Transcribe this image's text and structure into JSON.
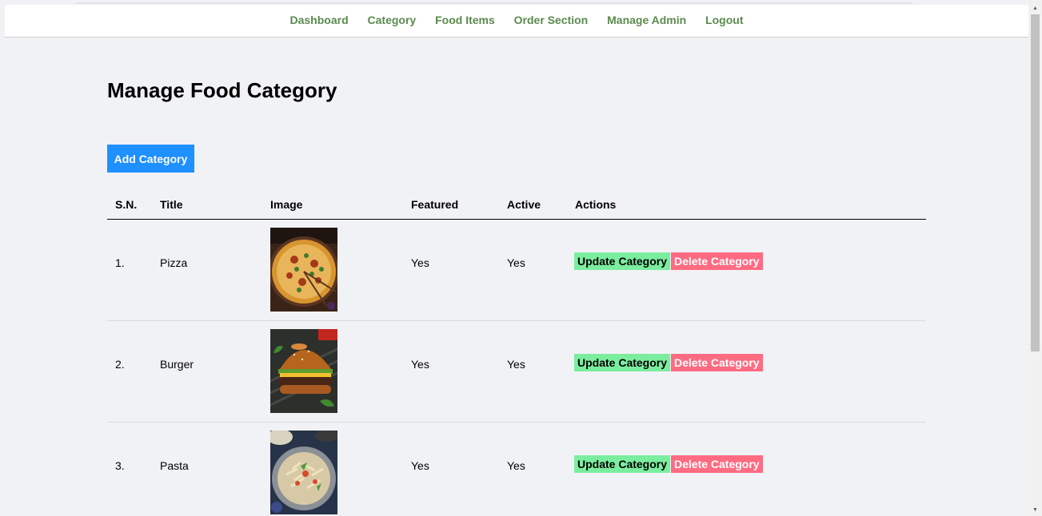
{
  "nav": {
    "items": [
      "Dashboard",
      "Category",
      "Food Items",
      "Order Section",
      "Manage Admin",
      "Logout"
    ]
  },
  "page": {
    "title": "Manage Food Category",
    "add_button": "Add Category"
  },
  "table": {
    "headers": [
      "S.N.",
      "Title",
      "Image",
      "Featured",
      "Active",
      "Actions"
    ],
    "rows": [
      {
        "sn": "1.",
        "title": "Pizza",
        "image": "pizza-image",
        "featured": "Yes",
        "active": "Yes",
        "update": "Update Category",
        "delete": "Delete Category"
      },
      {
        "sn": "2.",
        "title": "Burger",
        "image": "burger-image",
        "featured": "Yes",
        "active": "Yes",
        "update": "Update Category",
        "delete": "Delete Category"
      },
      {
        "sn": "3.",
        "title": "Pasta",
        "image": "pasta-image",
        "featured": "Yes",
        "active": "Yes",
        "update": "Update Category",
        "delete": "Delete Category"
      }
    ]
  },
  "colors": {
    "nav_link": "#5a8a4e",
    "add_button_bg": "#1e90ff",
    "update_button_bg": "#7bed9f",
    "delete_button_bg": "#ff6b81",
    "page_bg": "#f1f2f6"
  }
}
